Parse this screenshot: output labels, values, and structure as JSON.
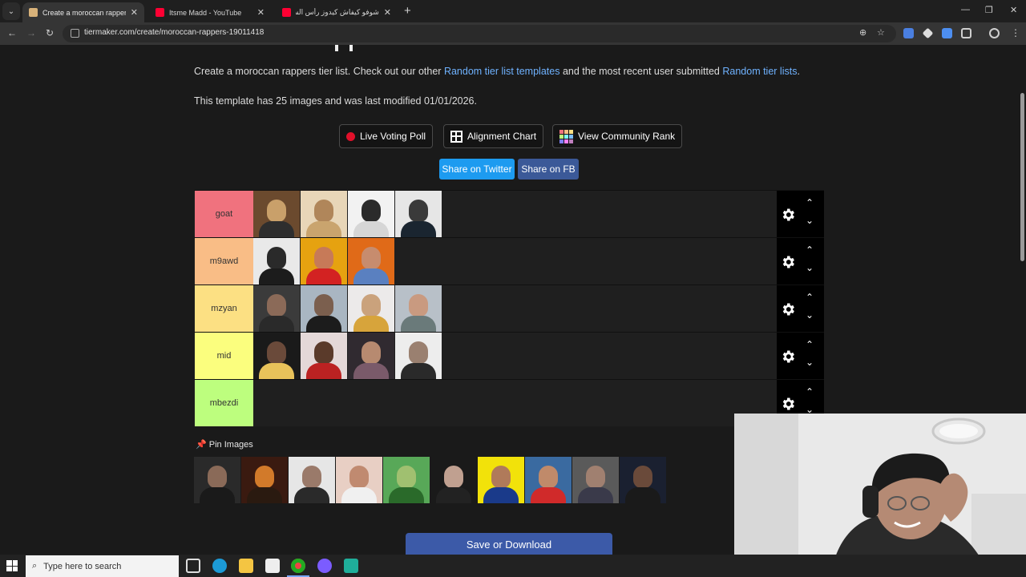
{
  "browser": {
    "tabs": [
      {
        "title": "Create a moroccan rappers Tie",
        "active": true
      },
      {
        "title": "Itsme Madd - YouTube",
        "active": false
      },
      {
        "title": "شوفو كيفاش كيدوز رأس السنة ف",
        "active": false
      }
    ],
    "url": "tiermaker.com/create/moroccan-rappers-19011418"
  },
  "page": {
    "desc_prefix": "Create a moroccan rappers tier list. Check out our other ",
    "link1": "Random tier list templates",
    "desc_mid": " and the most recent user submitted ",
    "link2": "Random tier lists",
    "desc_suffix": ".",
    "meta": "This template has 25 images and was last modified 01/01/2026.",
    "buttons": {
      "live_poll": "Live Voting Poll",
      "alignment": "Alignment Chart",
      "community": "View Community Rank"
    },
    "share": {
      "twitter": "Share on Twitter",
      "fb": "Share on FB"
    },
    "pin_label": "Pin Images",
    "save": "Save or Download"
  },
  "tiers": [
    {
      "label": "goat",
      "color": "#f0727e",
      "count": 4
    },
    {
      "label": "m9awd",
      "color": "#f9bd86",
      "count": 3
    },
    {
      "label": "mzyan",
      "color": "#fce083",
      "count": 4
    },
    {
      "label": "mid",
      "color": "#fbfe7e",
      "count": 4
    },
    {
      "label": "mbezdi",
      "color": "#bdfe7e",
      "count": 0
    }
  ],
  "pool_count": 10,
  "taskbar": {
    "search_placeholder": "Type here to search"
  },
  "colors": {
    "accent_link": "#6fb2ff",
    "twitter": "#1d9bf0",
    "fb": "#3b5998",
    "save": "#3c5aa8"
  }
}
